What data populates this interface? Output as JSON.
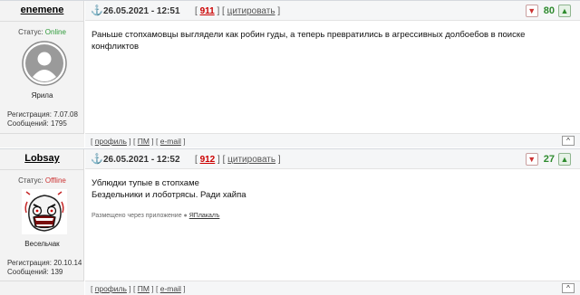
{
  "posts": [
    {
      "username": "enemene",
      "status_label": "Статус: ",
      "status_value": "Online",
      "rank": "Ярила",
      "registration": "Регистрация: 7.07.08",
      "messages": "Сообщений: 1795",
      "date": "26.05.2021 - 12:51",
      "number": "911",
      "quote": "цитировать",
      "score": "80",
      "text": "Раньше стопхамовцы выглядели как робин гуды, а теперь превратились в агрессивных долбоебов в поиске конфликтов",
      "footer": {
        "profile": "профиль",
        "pm": "ПМ",
        "email": "e-mail",
        "top": "[^]"
      }
    },
    {
      "username": "Lobsay",
      "status_label": "Статус: ",
      "status_value": "Offline",
      "rank": "Весельчак",
      "registration": "Регистрация: 20.10.14",
      "messages": "Сообщений: 139",
      "date": "26.05.2021 - 12:52",
      "number": "912",
      "quote": "цитировать",
      "score": "27",
      "text_line1": "Ублюдки тупые в стопхаме",
      "text_line2": "Бездельники и лоботрясы. Ради хайпа",
      "via_label": "Размещено через приложение",
      "via_app": "ЯПлакалъ",
      "footer": {
        "profile": "профиль",
        "pm": "ПМ",
        "email": "e-mail",
        "top": "[^]"
      }
    }
  ],
  "colors": {
    "online": "#2f9b3a",
    "offline": "#cc3333",
    "score": "#2e8b2e",
    "post_number": "#cc0000"
  },
  "icons": [
    "anchor-icon",
    "thumb-down-icon",
    "thumb-up-icon",
    "default-avatar-icon",
    "rage-face-avatar",
    "app-icon"
  ]
}
